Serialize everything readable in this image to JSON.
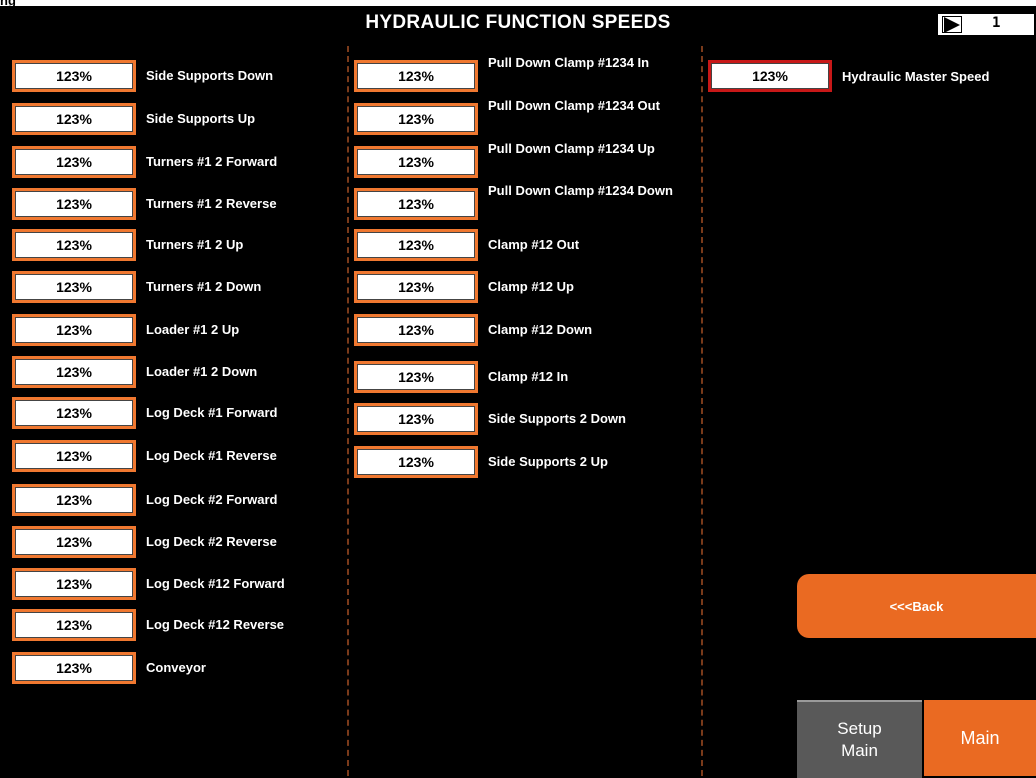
{
  "header": {
    "corner_label": "ng",
    "title": "HYDRAULIC FUNCTION SPEEDS",
    "page_number": "1"
  },
  "col1": [
    {
      "value": "123%",
      "label": "Side Supports Down"
    },
    {
      "value": "123%",
      "label": "Side Supports Up"
    },
    {
      "value": "123%",
      "label": "Turners #1 2 Forward"
    },
    {
      "value": "123%",
      "label": "Turners #1 2 Reverse"
    },
    {
      "value": "123%",
      "label": "Turners #1 2 Up"
    },
    {
      "value": "123%",
      "label": "Turners #1 2 Down"
    },
    {
      "value": "123%",
      "label": "Loader #1 2 Up"
    },
    {
      "value": "123%",
      "label": "Loader #1 2 Down"
    },
    {
      "value": "123%",
      "label": "Log Deck #1 Forward"
    },
    {
      "value": "123%",
      "label": "Log Deck #1 Reverse"
    },
    {
      "value": "123%",
      "label": "Log Deck #2 Forward"
    },
    {
      "value": "123%",
      "label": "Log Deck #2 Reverse"
    },
    {
      "value": "123%",
      "label": "Log Deck #12 Forward"
    },
    {
      "value": "123%",
      "label": "Log Deck #12 Reverse"
    },
    {
      "value": "123%",
      "label": "Conveyor"
    }
  ],
  "col2": [
    {
      "value": "123%",
      "label": "Pull Down Clamp #1234 In"
    },
    {
      "value": "123%",
      "label": "Pull Down Clamp #1234 Out"
    },
    {
      "value": "123%",
      "label": "Pull Down Clamp #1234 Up"
    },
    {
      "value": "123%",
      "label": "Pull Down Clamp #1234 Down"
    },
    {
      "value": "123%",
      "label": "Clamp #12 Out"
    },
    {
      "value": "123%",
      "label": "Clamp #12 Up"
    },
    {
      "value": "123%",
      "label": "Clamp #12 Down"
    },
    {
      "value": "123%",
      "label": "Clamp #12 In"
    },
    {
      "value": "123%",
      "label": "Side Supports 2 Down"
    },
    {
      "value": "123%",
      "label": "Side Supports 2 Up"
    }
  ],
  "master": {
    "value": "123%",
    "label": "Hydraulic Master Speed"
  },
  "buttons": {
    "back": "<<<Back",
    "setup_line1": "Setup",
    "setup_line2": "Main",
    "main": "Main"
  },
  "colors": {
    "accent": "#ea6a22",
    "master_border": "#c81818",
    "background": "#000000"
  }
}
